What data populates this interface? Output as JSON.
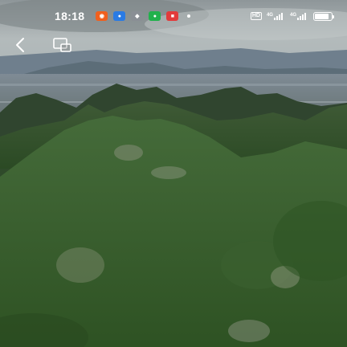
{
  "status_bar": {
    "time": "18:18",
    "notification_icons": [
      {
        "icon": "notification-app-icon-orange",
        "color": "#f0601e",
        "glyph": "◉"
      },
      {
        "icon": "notification-app-icon-blue",
        "color": "#2a7be4",
        "glyph": "●"
      },
      {
        "icon": "notification-app-icon-gray",
        "color": "#8a8f95",
        "glyph": "◆"
      },
      {
        "icon": "notification-app-icon-green",
        "color": "#22b14c",
        "glyph": "●"
      },
      {
        "icon": "notification-app-icon-red",
        "color": "#e23b3b",
        "glyph": "■"
      }
    ],
    "hd_label": "HD",
    "network_1": "4G",
    "network_2": "4G",
    "battery_level": 0.85
  },
  "toolbar": {
    "back_icon": "back-arrow-icon",
    "pip_icon": "picture-in-picture-icon"
  },
  "content": {
    "type": "video-frame",
    "description_icon": "aerial-karst-landscape-image"
  }
}
